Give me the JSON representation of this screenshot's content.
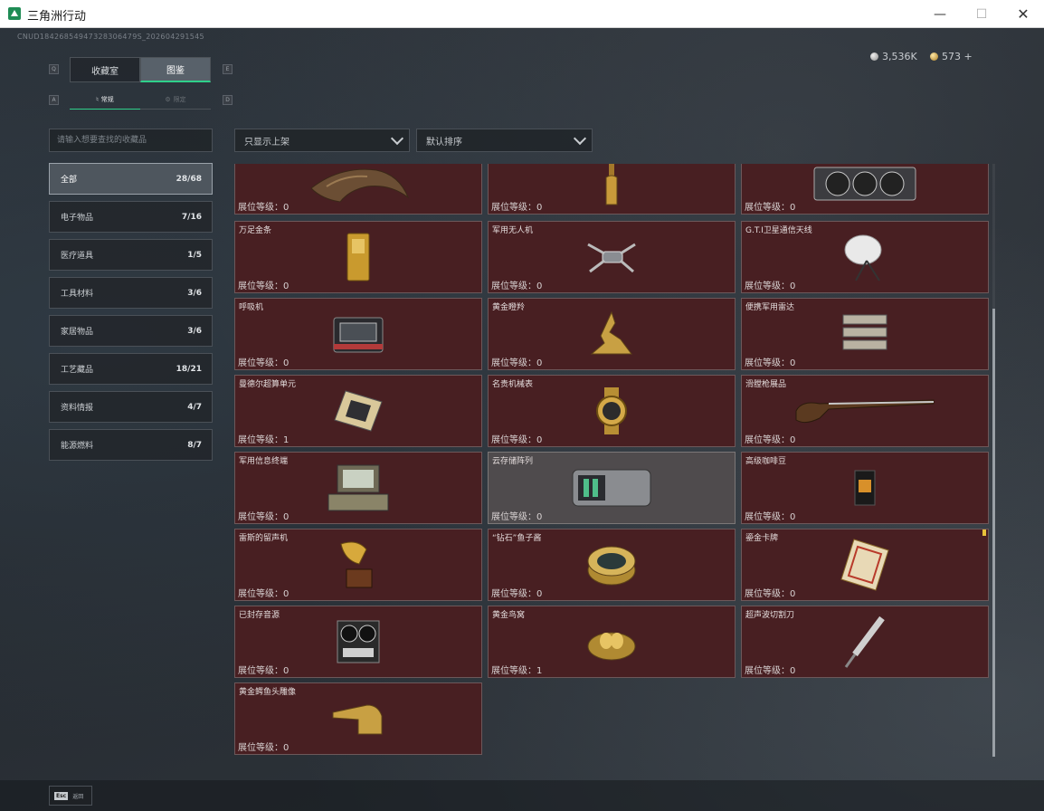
{
  "window": {
    "title": "三角洲行动"
  },
  "uid": "CNUD18426854947328306479S_202604291545",
  "currency": {
    "silver": "3,536K",
    "gold": "573 +"
  },
  "tabs": {
    "main": [
      {
        "label": "收藏室",
        "active": false
      },
      {
        "label": "图鉴",
        "active": true
      }
    ],
    "sub": [
      {
        "label": "常规",
        "active": true
      },
      {
        "label": "限定",
        "active": false
      }
    ],
    "keys": [
      "Q",
      "E",
      "A",
      "D"
    ]
  },
  "search": {
    "placeholder": "请输入想要查找的收藏品"
  },
  "filters": {
    "shelf": "只显示上架",
    "sort": "默认排序"
  },
  "categories": [
    {
      "label": "全部",
      "count": "28/68",
      "active": true
    },
    {
      "label": "电子物品",
      "count": "7/16"
    },
    {
      "label": "医疗道具",
      "count": "1/5"
    },
    {
      "label": "工具材料",
      "count": "3/6"
    },
    {
      "label": "家居物品",
      "count": "3/6"
    },
    {
      "label": "工艺藏品",
      "count": "18/21"
    },
    {
      "label": "资料情报",
      "count": "4/7"
    },
    {
      "label": "能源燃料",
      "count": "8/7"
    }
  ],
  "level_label": "展位等级：",
  "items": [
    {
      "name": "",
      "level": "0",
      "icon": "claw-icon"
    },
    {
      "name": "",
      "level": "0",
      "icon": "bottle-icon"
    },
    {
      "name": "",
      "level": "0",
      "icon": "graphics-card-icon"
    },
    {
      "name": "万足金条",
      "level": "0",
      "icon": "gold-bar-icon"
    },
    {
      "name": "军用无人机",
      "level": "0",
      "icon": "drone-icon"
    },
    {
      "name": "G.T.I卫星通信天线",
      "level": "0",
      "icon": "satellite-dish-icon"
    },
    {
      "name": "呼吸机",
      "level": "0",
      "icon": "ventilator-icon"
    },
    {
      "name": "黄金瞪羚",
      "level": "0",
      "icon": "gazelle-icon"
    },
    {
      "name": "便携军用雷达",
      "level": "0",
      "icon": "radar-icon"
    },
    {
      "name": "曼德尔超算单元",
      "level": "1",
      "icon": "cpu-icon"
    },
    {
      "name": "名贵机械表",
      "level": "0",
      "icon": "watch-icon"
    },
    {
      "name": "滑膛枪展品",
      "level": "0",
      "icon": "musket-icon"
    },
    {
      "name": "军用信息终端",
      "level": "0",
      "icon": "terminal-icon"
    },
    {
      "name": "云存储阵列",
      "level": "0",
      "icon": "storage-array-icon",
      "dim": true
    },
    {
      "name": "高级咖啡豆",
      "level": "0",
      "icon": "coffee-icon"
    },
    {
      "name": "雷斯的留声机",
      "level": "0",
      "icon": "gramophone-icon"
    },
    {
      "name": "“钻石”鱼子酱",
      "level": "0",
      "icon": "caviar-icon"
    },
    {
      "name": "鎏金卡牌",
      "level": "0",
      "icon": "card-icon",
      "flag": true
    },
    {
      "name": "已封存音源",
      "level": "0",
      "icon": "tape-recorder-icon"
    },
    {
      "name": "黄金鸟窝",
      "level": "1",
      "icon": "nest-icon"
    },
    {
      "name": "超声波切割刀",
      "level": "0",
      "icon": "cutter-icon"
    },
    {
      "name": "黄金鳄鱼头雕像",
      "level": "0",
      "icon": "crocodile-icon"
    }
  ],
  "footer": {
    "esc_key": "Esc",
    "back": "返回"
  }
}
